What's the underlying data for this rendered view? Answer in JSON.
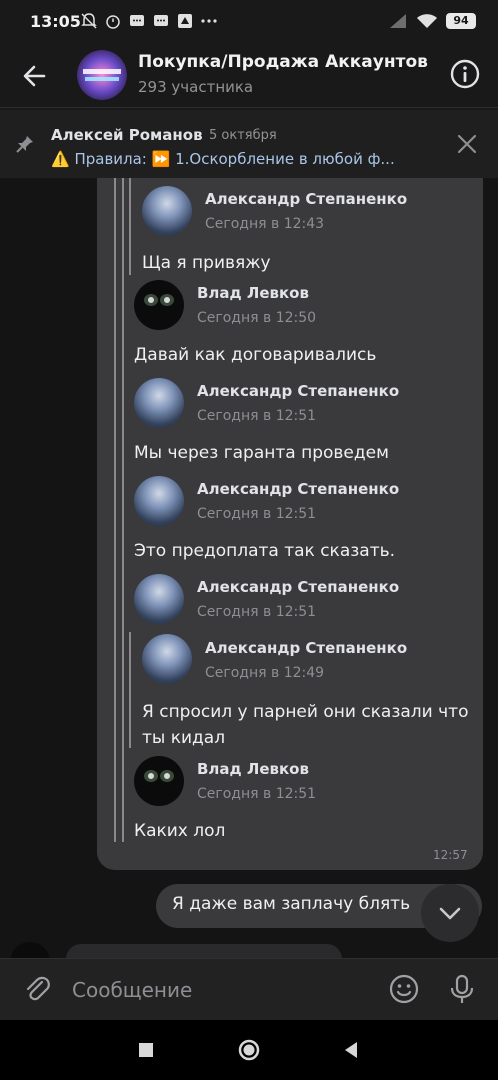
{
  "status": {
    "time": "13:05",
    "battery": "94"
  },
  "header": {
    "title": "Покупка/Продажа Аккаунтов К",
    "subtitle": "293 участника"
  },
  "pinned": {
    "author": "Алексей Романов",
    "date": "5 октября",
    "text": "⚠️ Правила: ⏩ 1.Оскорбление в любой ф..."
  },
  "messages": [
    {
      "name": "Александр Степаненко",
      "time": "Сегодня в 12:43",
      "text": "Ща я привяжу"
    },
    {
      "name": "Влад Левков",
      "time": "Сегодня в 12:50",
      "text": "Давай как договаривались"
    },
    {
      "name": "Александр Степаненко",
      "time": "Сегодня в 12:51",
      "text": "Мы через гаранта проведем"
    },
    {
      "name": "Александр Степаненко",
      "time": "Сегодня в 12:51",
      "text": "Это предоплата так сказать."
    },
    {
      "name": "Александр Степаненко",
      "time": "Сегодня в 12:51",
      "text": ""
    },
    {
      "name": "Александр Степаненко",
      "time": "Сегодня в 12:49",
      "text": "Я спросил у парней они сказали что ты кидал"
    },
    {
      "name": "Влад Левков",
      "time": "Сегодня в 12:51",
      "text": "Каких лол"
    }
  ],
  "bubble": {
    "time": "12:57"
  },
  "outgoing": {
    "text": "Я даже вам заплачу блять"
  },
  "composer": {
    "placeholder": "Сообщение"
  },
  "icons": {
    "back": "back-arrow-icon",
    "info": "info-icon",
    "pin": "pin-icon",
    "close": "close-icon",
    "attach": "paperclip-icon",
    "emoji": "smiley-icon",
    "mic": "microphone-icon",
    "scroll": "chevron-down-icon"
  }
}
